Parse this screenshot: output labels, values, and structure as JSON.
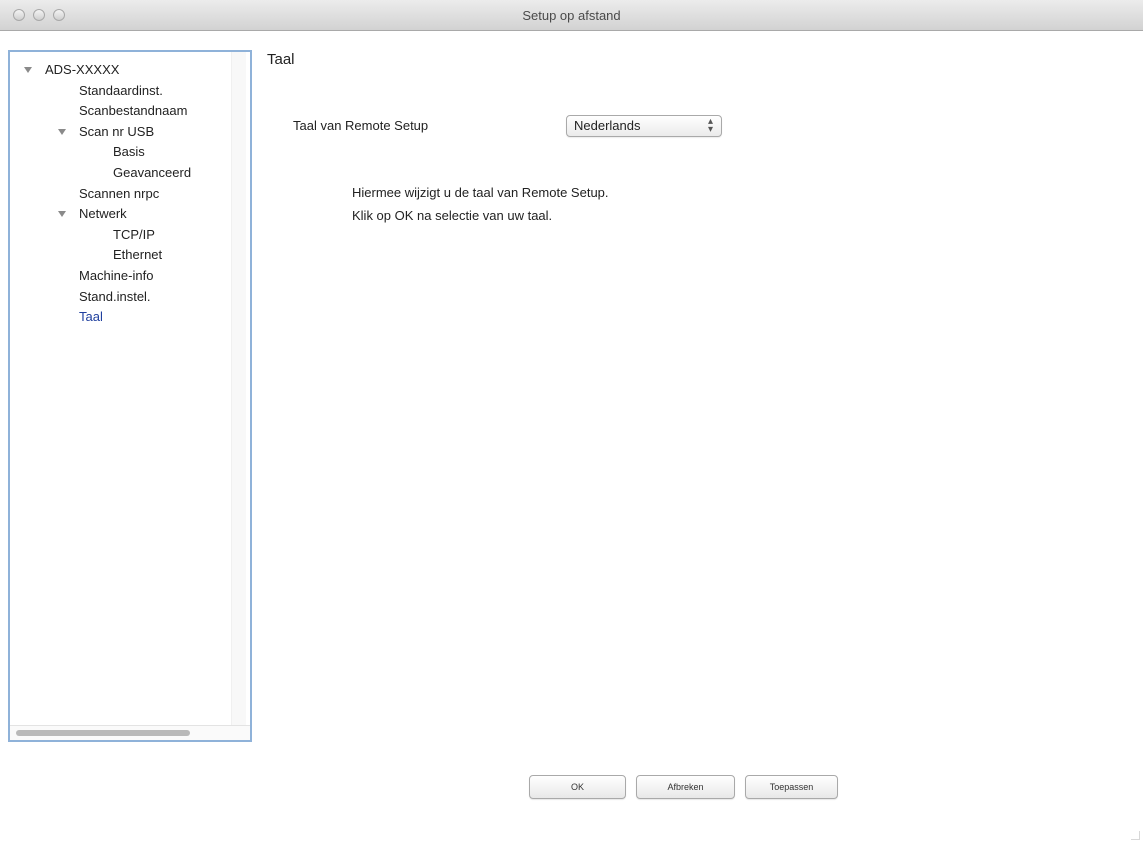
{
  "window": {
    "title": "Setup op afstand"
  },
  "sidebar": {
    "items": [
      {
        "label": "ADS-XXXXX",
        "level": 0,
        "expandable": true,
        "expanded": true
      },
      {
        "label": "Standaardinst.",
        "level": 1,
        "expandable": false
      },
      {
        "label": "Scanbestandnaam",
        "level": 1,
        "expandable": false
      },
      {
        "label": "Scan nr USB",
        "level": 1,
        "expandable": true,
        "expanded": true
      },
      {
        "label": "Basis",
        "level": 2,
        "expandable": false
      },
      {
        "label": "Geavanceerd",
        "level": 2,
        "expandable": false
      },
      {
        "label": "Scannen nrpc",
        "level": 1,
        "expandable": false
      },
      {
        "label": "Netwerk",
        "level": 1,
        "expandable": true,
        "expanded": true
      },
      {
        "label": "TCP/IP",
        "level": 2,
        "expandable": false
      },
      {
        "label": "Ethernet",
        "level": 2,
        "expandable": false
      },
      {
        "label": "Machine-info",
        "level": 1,
        "expandable": false
      },
      {
        "label": "Stand.instel.",
        "level": 1,
        "expandable": false
      },
      {
        "label": "Taal",
        "level": 1,
        "expandable": false,
        "selected": true
      }
    ]
  },
  "panel": {
    "title": "Taal",
    "language_label": "Taal van Remote Setup",
    "language_select": {
      "value": "Nederlands",
      "arrows_icon": "updown-arrows-icon"
    },
    "description": [
      "Hiermee wijzigt u de taal van Remote Setup.",
      "Klik op OK na selectie van uw taal."
    ]
  },
  "buttons": {
    "ok": "OK",
    "cancel": "Afbreken",
    "apply": "Toepassen"
  },
  "colors": {
    "selection_text": "#1f3f9e",
    "focus_border": "#8fb2d9"
  }
}
